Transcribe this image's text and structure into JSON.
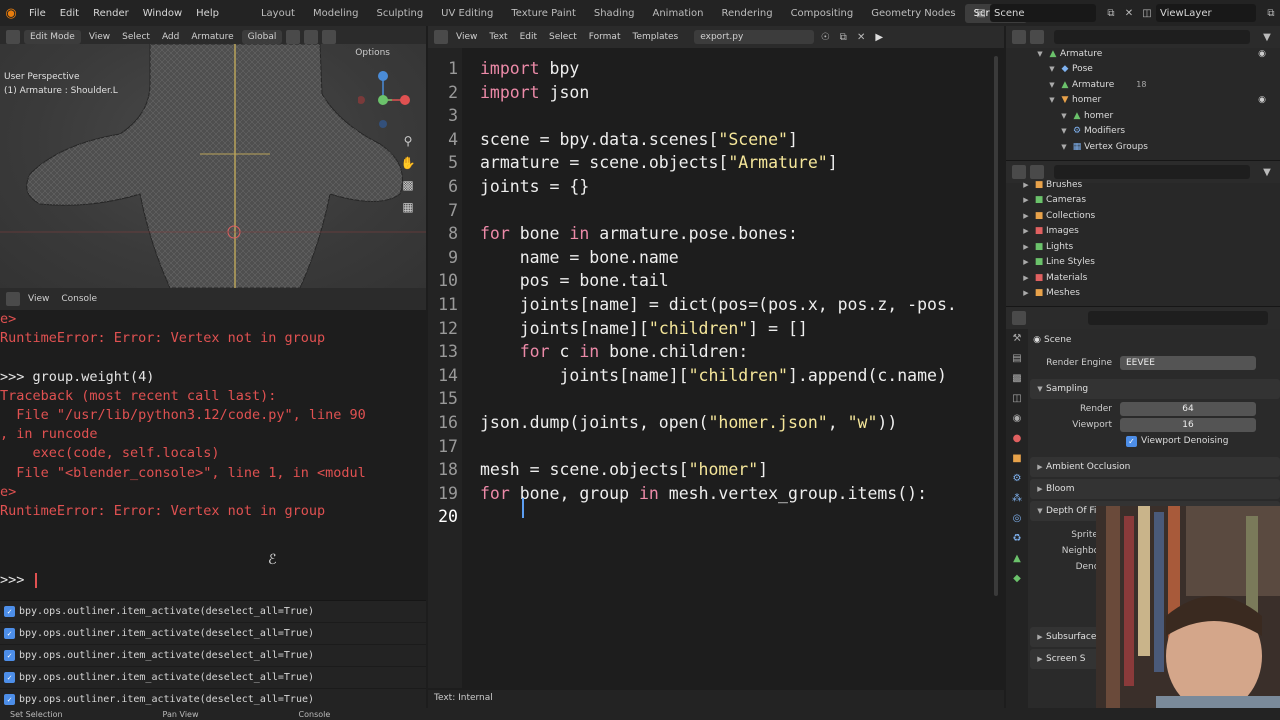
{
  "topbar": {
    "menus": [
      "File",
      "Edit",
      "Render",
      "Window",
      "Help"
    ],
    "workspaces": [
      "Layout",
      "Modeling",
      "Sculpting",
      "UV Editing",
      "Texture Paint",
      "Shading",
      "Animation",
      "Rendering",
      "Compositing",
      "Geometry Nodes",
      "Scripting"
    ],
    "active_workspace": "Scripting",
    "scene": "Scene",
    "view_layer": "ViewLayer"
  },
  "viewport": {
    "mode": "Edit Mode",
    "menus": [
      "View",
      "Select",
      "Add",
      "Armature"
    ],
    "orientation": "Global",
    "options": "Options",
    "title": "User Perspective",
    "subtitle": "(1) Armature : Shoulder.L"
  },
  "console": {
    "header": [
      "View",
      "Console"
    ],
    "lines": [
      {
        "text": "e>",
        "type": "err"
      },
      {
        "text": "RuntimeError: Error: Vertex not in group",
        "type": "err"
      },
      {
        "text": "",
        "type": "nrm"
      },
      {
        "text": ">>> group.weight(4)",
        "type": "nrm"
      },
      {
        "text": "Traceback (most recent call last):",
        "type": "err"
      },
      {
        "text": "  File \"/usr/lib/python3.12/code.py\", line 90",
        "type": "err"
      },
      {
        "text": ", in runcode",
        "type": "err"
      },
      {
        "text": "    exec(code, self.locals)",
        "type": "err"
      },
      {
        "text": "  File \"<blender_console>\", line 1, in <modul",
        "type": "err"
      },
      {
        "text": "e>",
        "type": "err"
      },
      {
        "text": "RuntimeError: Error: Vertex not in group",
        "type": "err"
      },
      {
        "text": "",
        "type": "nrm"
      },
      {
        "text": "",
        "type": "nrm"
      }
    ],
    "prompt": ">>> "
  },
  "infolog": {
    "rows": [
      "bpy.ops.outliner.item_activate(deselect_all=True)",
      "bpy.ops.outliner.item_activate(deselect_all=True)",
      "bpy.ops.outliner.item_activate(deselect_all=True)",
      "bpy.ops.outliner.item_activate(deselect_all=True)",
      "bpy.ops.outliner.item_activate(deselect_all=True)"
    ]
  },
  "statusbar": [
    "Set Selection",
    "Pan View",
    "Console"
  ],
  "texteditor": {
    "menus": [
      "View",
      "Text",
      "Edit",
      "Select",
      "Format",
      "Templates"
    ],
    "filename": "export.py",
    "footer": "Text: Internal",
    "current_line": "20",
    "lines": [
      {
        "n": "1",
        "tokens": [
          [
            "kw",
            "import"
          ],
          [
            "p",
            " bpy"
          ]
        ]
      },
      {
        "n": "2",
        "tokens": [
          [
            "kw",
            "import"
          ],
          [
            "p",
            " json"
          ]
        ]
      },
      {
        "n": "3",
        "tokens": []
      },
      {
        "n": "4",
        "tokens": [
          [
            "p",
            "scene = bpy.data.scenes["
          ],
          [
            "str",
            "\"Scene\""
          ],
          [
            "p",
            "]"
          ]
        ]
      },
      {
        "n": "5",
        "tokens": [
          [
            "p",
            "armature = scene.objects["
          ],
          [
            "str",
            "\"Armature\""
          ],
          [
            "p",
            "]"
          ]
        ]
      },
      {
        "n": "6",
        "tokens": [
          [
            "p",
            "joints = {}"
          ]
        ]
      },
      {
        "n": "7",
        "tokens": []
      },
      {
        "n": "8",
        "tokens": [
          [
            "kw",
            "for"
          ],
          [
            "p",
            " bone "
          ],
          [
            "kw",
            "in"
          ],
          [
            "p",
            " armature.pose.bones:"
          ]
        ]
      },
      {
        "n": "9",
        "tokens": [
          [
            "p",
            "    name = bone.name"
          ]
        ]
      },
      {
        "n": "10",
        "tokens": [
          [
            "p",
            "    pos = bone.tail"
          ]
        ]
      },
      {
        "n": "11",
        "tokens": [
          [
            "p",
            "    joints[name] = dict(pos=(pos.x, pos.z, -pos."
          ]
        ]
      },
      {
        "n": "12",
        "tokens": [
          [
            "p",
            "    joints[name]["
          ],
          [
            "str",
            "\"children\""
          ],
          [
            "p",
            "] = []"
          ]
        ]
      },
      {
        "n": "13",
        "tokens": [
          [
            "p",
            "    "
          ],
          [
            "kw",
            "for"
          ],
          [
            "p",
            " c "
          ],
          [
            "kw",
            "in"
          ],
          [
            "p",
            " bone.children:"
          ]
        ]
      },
      {
        "n": "14",
        "tokens": [
          [
            "p",
            "        joints[name]["
          ],
          [
            "str",
            "\"children\""
          ],
          [
            "p",
            "].append(c.name)"
          ]
        ]
      },
      {
        "n": "15",
        "tokens": []
      },
      {
        "n": "16",
        "tokens": [
          [
            "p",
            "json.dump(joints, open("
          ],
          [
            "str",
            "\"homer.json\""
          ],
          [
            "p",
            ", "
          ],
          [
            "str",
            "\"w\""
          ],
          [
            "p",
            "))"
          ]
        ]
      },
      {
        "n": "17",
        "tokens": []
      },
      {
        "n": "18",
        "tokens": [
          [
            "p",
            "mesh = scene.objects["
          ],
          [
            "str",
            "\"homer\""
          ],
          [
            "p",
            "]"
          ]
        ]
      },
      {
        "n": "19",
        "tokens": [
          [
            "kw",
            "for"
          ],
          [
            "p",
            " bone, group "
          ],
          [
            "kw",
            "in"
          ],
          [
            "p",
            " mesh.vertex_group.items():"
          ]
        ]
      },
      {
        "n": "20",
        "tokens": [
          [
            "p",
            "    "
          ]
        ]
      }
    ]
  },
  "outliner": {
    "rows": [
      {
        "label": "Armature",
        "indent": 1,
        "icon": "armature-icon"
      },
      {
        "label": "Pose",
        "indent": 2,
        "icon": "pose-icon"
      },
      {
        "label": "Armature",
        "indent": 2,
        "icon": "armature-data-icon",
        "extra": "18"
      },
      {
        "label": "homer",
        "indent": 2,
        "icon": "mesh-object-icon"
      },
      {
        "label": "homer",
        "indent": 3,
        "icon": "mesh-data-icon"
      },
      {
        "label": "Modifiers",
        "indent": 3,
        "icon": "modifier-icon"
      },
      {
        "label": "Vertex Groups",
        "indent": 3,
        "icon": "vertex-group-icon"
      }
    ]
  },
  "datablocks": {
    "rows": [
      "Brushes",
      "Cameras",
      "Collections",
      "Images",
      "Lights",
      "Line Styles",
      "Materials",
      "Meshes"
    ]
  },
  "properties": {
    "scene": "Scene",
    "render_engine_label": "Render Engine",
    "render_engine": "EEVEE",
    "sampling": "Sampling",
    "render_label": "Render",
    "render_value": "64",
    "viewport_label": "Viewport",
    "viewport_value": "16",
    "viewport_denoising": "Viewport Denoising",
    "sections": [
      "Ambient Occlusion",
      "Bloom",
      "Depth Of Fi"
    ],
    "partial_labels": [
      "Sprite Th",
      "Neighbor R",
      "Denoise"
    ],
    "bottom_sections": [
      "Subsurface",
      "Screen S"
    ]
  }
}
